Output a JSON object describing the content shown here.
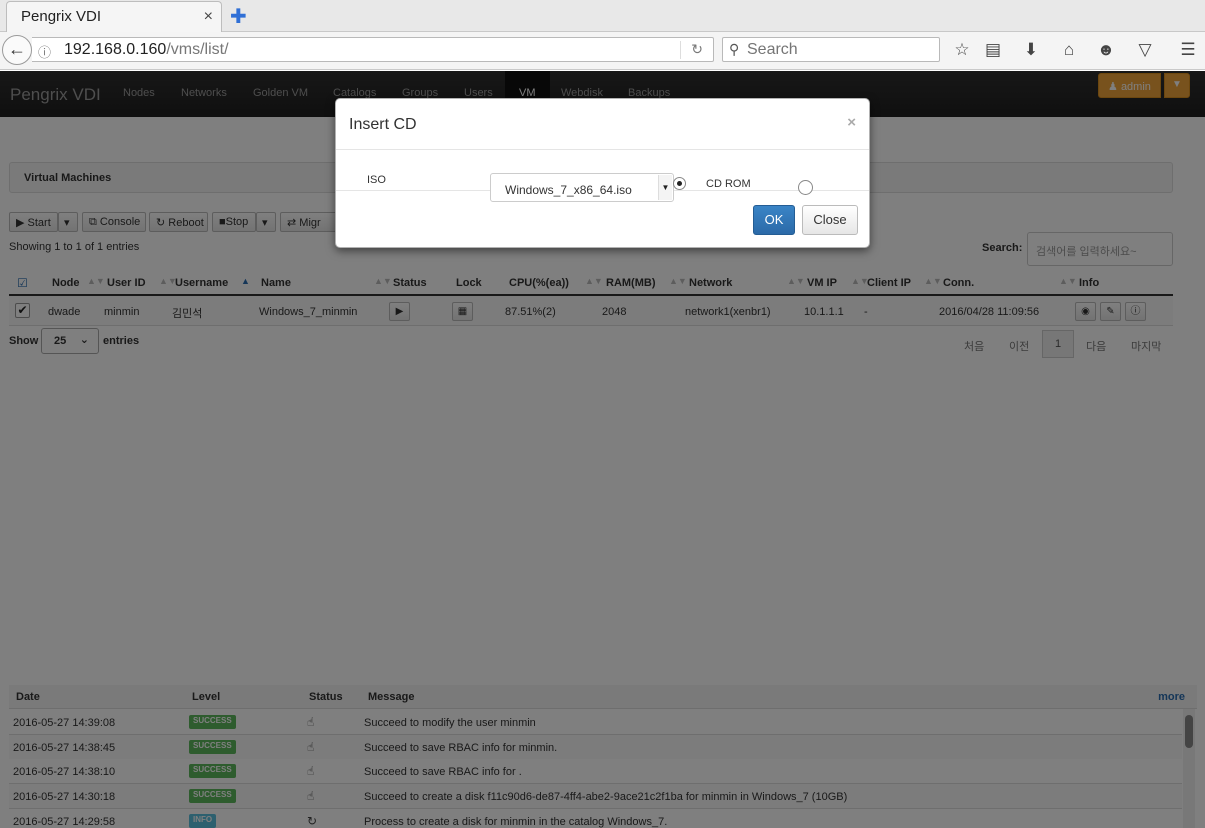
{
  "browser": {
    "tab_title": "Pengrix VDI",
    "tab_close": "×",
    "new_tab": "✚",
    "url_host": "192.168.0.160",
    "url_path": "/vms/list/",
    "search_placeholder": "Search"
  },
  "app": {
    "brand": "Pengrix VDI",
    "nav": [
      "Nodes",
      "Networks",
      "Golden VM",
      "Catalogs",
      "Groups",
      "Users",
      "VM",
      "Webdisk",
      "Backups"
    ],
    "active_nav": "VM",
    "admin_label": "admin"
  },
  "panel": {
    "title": "Virtual Machines"
  },
  "toolbar": {
    "start": "Start",
    "console": "Console",
    "reboot": "Reboot",
    "stop": "Stop",
    "migrate": "Migr"
  },
  "table": {
    "showing": "Showing 1 to 1 of 1 entries",
    "search_label": "Search:",
    "search_placeholder": "검색어를 입력하세요~",
    "columns": [
      "Node",
      "User ID",
      "Username",
      "Name",
      "Status",
      "Lock",
      "CPU(%(ea))",
      "RAM(MB)",
      "Network",
      "VM IP",
      "Client IP",
      "Conn.",
      "Info"
    ],
    "rows": [
      {
        "node": "dwade",
        "user_id": "minmin",
        "username": "김민석",
        "name": "Windows_7_minmin",
        "cpu": "87.51%(2)",
        "ram": "2048",
        "network": "network1(xenbr1)",
        "vm_ip": "10.1.1.1",
        "client_ip": "-",
        "conn": "2016/04/28 11:09:56"
      }
    ],
    "show_label": "Show",
    "page_size": "25",
    "entries_label": "entries",
    "pagination": {
      "first": "처음",
      "prev": "이전",
      "current": "1",
      "next": "다음",
      "last": "마지막"
    }
  },
  "log": {
    "columns": [
      "Date",
      "Level",
      "Status",
      "Message"
    ],
    "more": "more",
    "rows": [
      {
        "date": "2016-05-27 14:39:08",
        "level": "SUCCESS",
        "message": "Succeed to modify the user minmin"
      },
      {
        "date": "2016-05-27 14:38:45",
        "level": "SUCCESS",
        "message": "Succeed to save RBAC info for minmin."
      },
      {
        "date": "2016-05-27 14:38:10",
        "level": "SUCCESS",
        "message": "Succeed to save RBAC info for ."
      },
      {
        "date": "2016-05-27 14:30:18",
        "level": "SUCCESS",
        "message": "Succeed to create a disk f11c90d6-de87-4ff4-abe2-9ace21c2f1ba for minmin in Windows_7 (10GB)"
      },
      {
        "date": "2016-05-27 14:29:58",
        "level": "INFO",
        "message": "Process to create a disk for minmin in the catalog Windows_7."
      }
    ]
  },
  "modal": {
    "title": "Insert CD",
    "close_x": "×",
    "iso_label": "ISO",
    "iso_value": "Windows_7_x86_64.iso",
    "cdrom_label": "CD ROM",
    "ok": "OK",
    "close": "Close"
  }
}
